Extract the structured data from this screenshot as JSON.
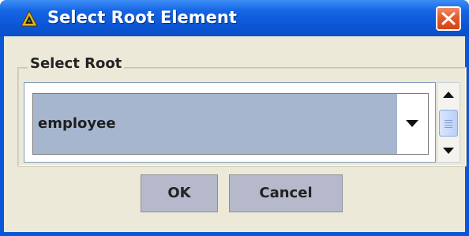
{
  "window": {
    "title": "Select Root Element",
    "close_icon": "close-icon",
    "app_icon": "app-triangle-icon"
  },
  "group": {
    "label": "Select Root"
  },
  "combo": {
    "selected": "employee",
    "arrow_icon": "chevron-down-icon"
  },
  "scrollbar": {
    "up_icon": "arrow-up-icon",
    "down_icon": "arrow-down-icon"
  },
  "buttons": {
    "ok": "OK",
    "cancel": "Cancel"
  },
  "colors": {
    "titlebar": "#0b56d6",
    "close": "#e25b2f",
    "combo_bg": "#a7b6cf",
    "button_bg": "#b6b9cc",
    "client_bg": "#ece9d8"
  }
}
